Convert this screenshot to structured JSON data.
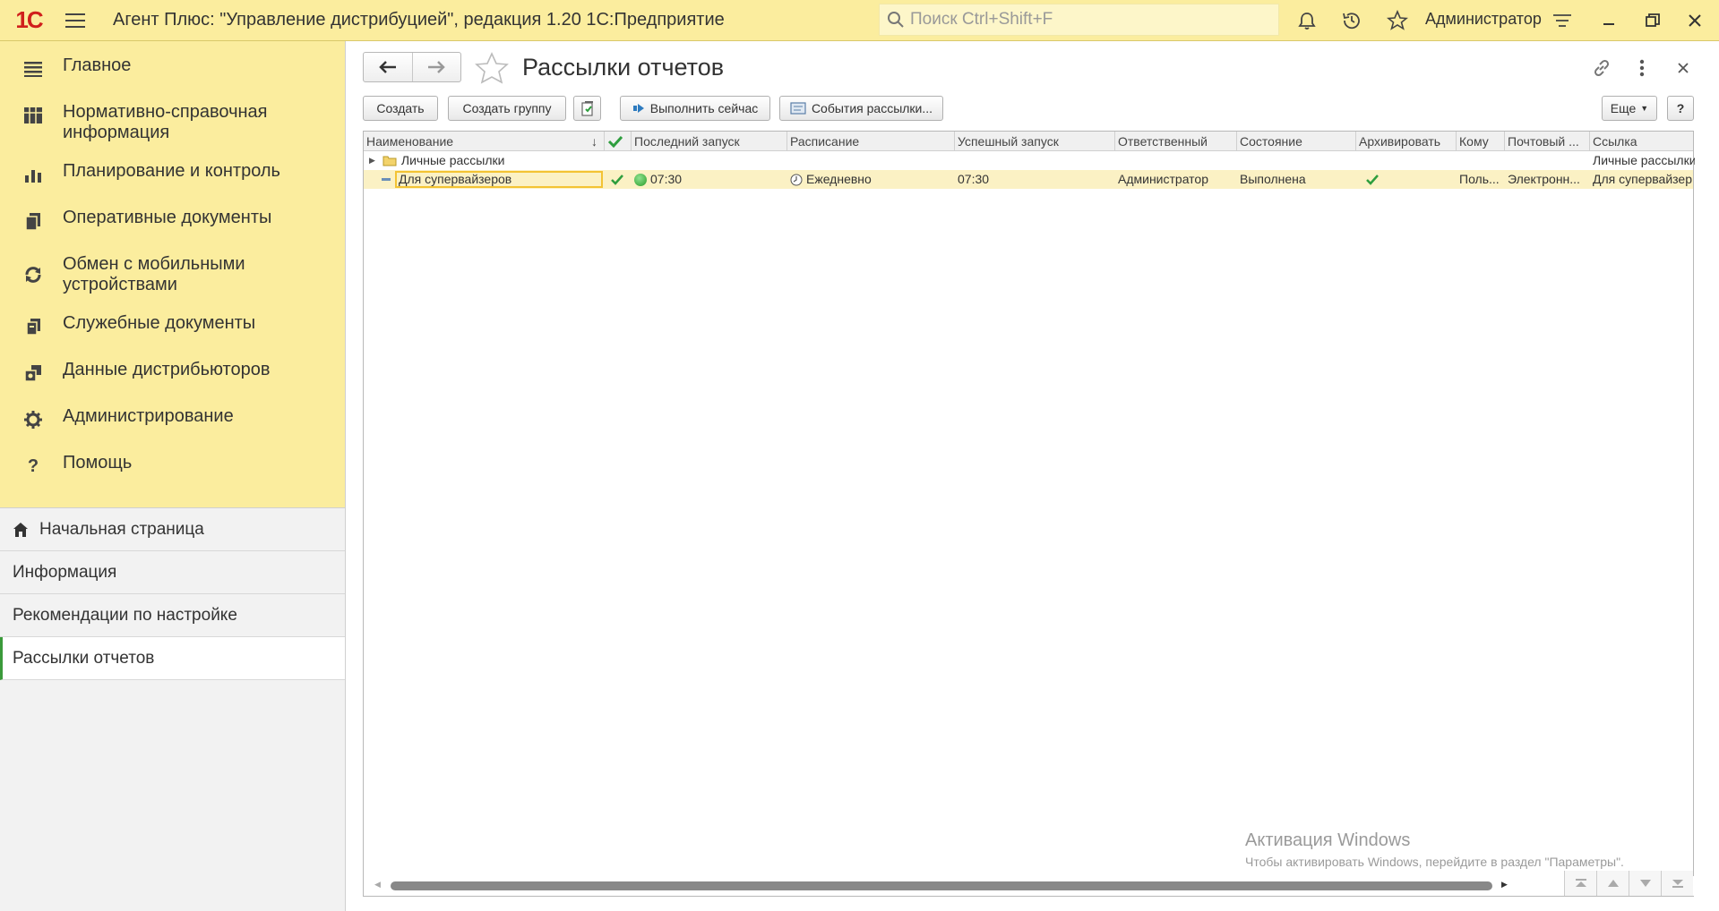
{
  "app": {
    "logo": "1С",
    "title": "Агент Плюс: \"Управление дистрибуцией\", редакция 1.20 1С:Предприятие",
    "search_placeholder": "Поиск Ctrl+Shift+F",
    "user": "Администратор"
  },
  "sidebar": {
    "sections": [
      {
        "label": "Главное",
        "icon": "menu-lines-icon"
      },
      {
        "label": "Нормативно-справочная информация",
        "icon": "catalog-icon"
      },
      {
        "label": "Планирование и контроль",
        "icon": "chart-bars-icon"
      },
      {
        "label": "Оперативные документы",
        "icon": "documents-icon"
      },
      {
        "label": "Обмен с мобильными устройствами",
        "icon": "sync-icon"
      },
      {
        "label": "Служебные документы",
        "icon": "service-docs-icon"
      },
      {
        "label": "Данные дистрибьюторов",
        "icon": "distributor-data-icon"
      },
      {
        "label": "Администрирование",
        "icon": "gear-icon"
      },
      {
        "label": "Помощь",
        "icon": "question-icon"
      }
    ],
    "open_windows": [
      {
        "label": "Начальная страница",
        "home": true,
        "active": false
      },
      {
        "label": "Информация",
        "active": false
      },
      {
        "label": "Рекомендации по настройке",
        "active": false
      },
      {
        "label": "Рассылки отчетов",
        "active": true
      }
    ]
  },
  "page": {
    "title": "Рассылки отчетов",
    "toolbar": {
      "create": "Создать",
      "create_group": "Создать группу",
      "run_now": "Выполнить сейчас",
      "events": "События рассылки...",
      "more": "Еще",
      "help": "?"
    },
    "table": {
      "columns": [
        "Наименование",
        "",
        "Последний запуск",
        "Расписание",
        "Успешный запуск",
        "Ответственный",
        "Состояние",
        "Архивировать",
        "Кому",
        "Почтовый ...",
        "Ссылка"
      ],
      "group_row": {
        "name": "Личные рассылки",
        "link": "Личные рассылки"
      },
      "rows": [
        {
          "name": "Для супервайзеров",
          "enabled": true,
          "last_run": "07:30",
          "schedule": "Ежедневно",
          "success_run": "07:30",
          "responsible": "Администратор",
          "state": "Выполнена",
          "archive": true,
          "to": "Поль...",
          "mail": "Электронн...",
          "link": "Для супервайзер"
        }
      ]
    }
  },
  "watermark": {
    "title": "Активация Windows",
    "text": "Чтобы активировать Windows, перейдите в раздел \"Параметры\"."
  },
  "colors": {
    "accent_yellow": "#fbed9e",
    "check_green": "#2e9e3e",
    "brand_red": "#d0201c"
  }
}
